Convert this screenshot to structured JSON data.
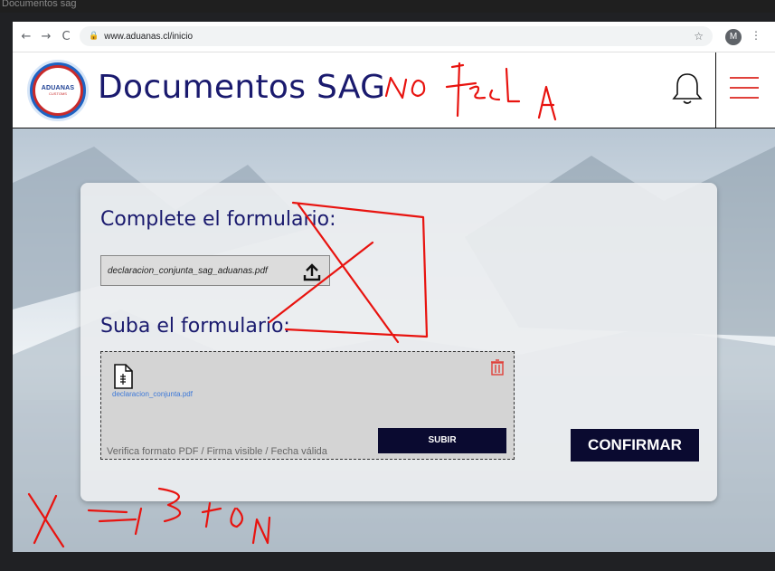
{
  "os_window": {
    "title": "Documentos sag"
  },
  "browser": {
    "url": "www.aduanas.cl/inicio",
    "avatar_letter": "M",
    "back_glyph": "←",
    "forward_glyph": "→",
    "reload_glyph": "C",
    "lock_glyph": "🔒",
    "star_glyph": "☆",
    "kebab_glyph": "⋮"
  },
  "header": {
    "title": "Documentos SAG",
    "logo_text": "ADUANAS",
    "logo_subtext": "CUSTOMS",
    "icons": [
      "bell-icon",
      "hamburger-menu-icon"
    ],
    "accent_color": "#e0413b",
    "brand_color": "#1a1a6e"
  },
  "form": {
    "heading_complete": "Complete el formulario:",
    "file_field_value": "declaracion_conjunta_sag_aduanas.pdf",
    "heading_upload": "Suba el formulario:",
    "uploaded_file_name": "declaracion_conjunta.pdf",
    "hint_text": "Verifica formato PDF / Firma visible / Fecha válida",
    "upload_button_label": "SUBIR",
    "confirm_button_label": "CONFIRMAR"
  },
  "annotations": {
    "header_note": "NO tecla",
    "bottom_note": "X → Boton",
    "ink_color": "#e8130f"
  }
}
